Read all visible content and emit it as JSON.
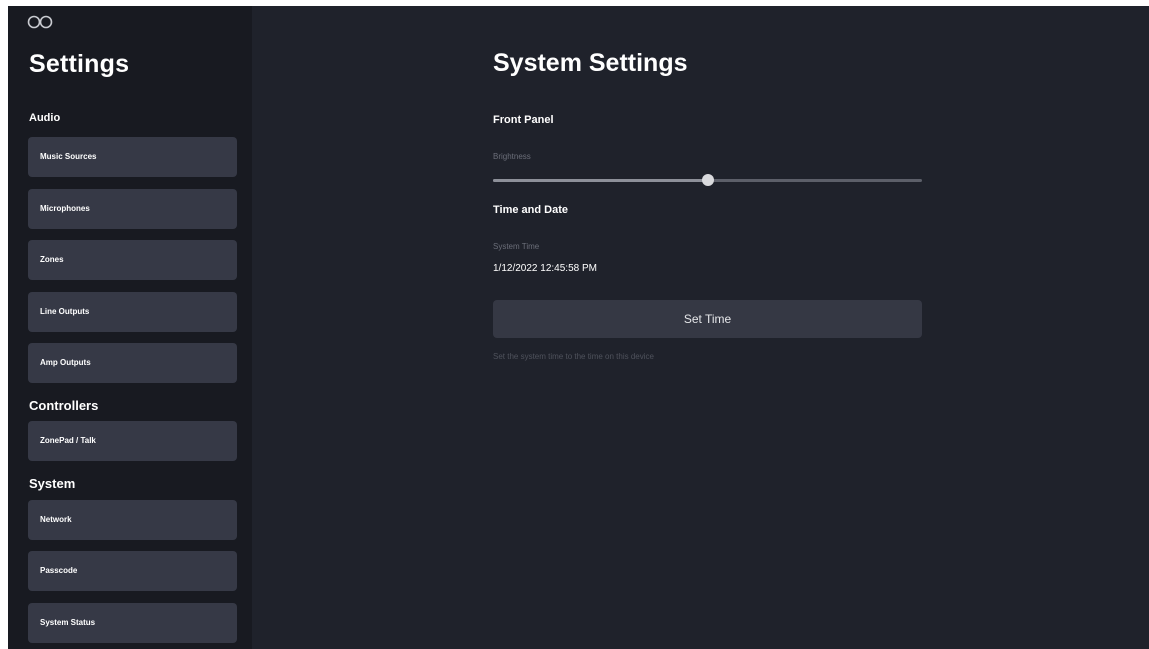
{
  "sidebar": {
    "logo_icon": "infinity-logo-icon",
    "title": "Settings",
    "sections": {
      "audio": {
        "label": "Audio",
        "items": [
          "Music Sources",
          "Microphones",
          "Zones",
          "Line Outputs",
          "Amp Outputs"
        ]
      },
      "controllers": {
        "label": "Controllers",
        "items": [
          "ZonePad / Talk"
        ]
      },
      "system": {
        "label": "System",
        "items": [
          "Network",
          "Passcode",
          "System Status"
        ]
      }
    }
  },
  "main": {
    "title": "System Settings",
    "front_panel": {
      "heading": "Front Panel",
      "brightness_label": "Brightness",
      "brightness_fraction": 0.5
    },
    "time_date": {
      "heading": "Time and Date",
      "system_time_label": "System Time",
      "system_time_value": "1/12/2022 12:45:58 PM",
      "set_time_label": "Set Time",
      "help_text": "Set the system time to the time on this device"
    }
  },
  "colors": {
    "background": "#1f222b",
    "sidebar_background": "#181a21",
    "button_background": "#363946",
    "text": "#ffffff",
    "muted_text": "#6b6e79"
  }
}
